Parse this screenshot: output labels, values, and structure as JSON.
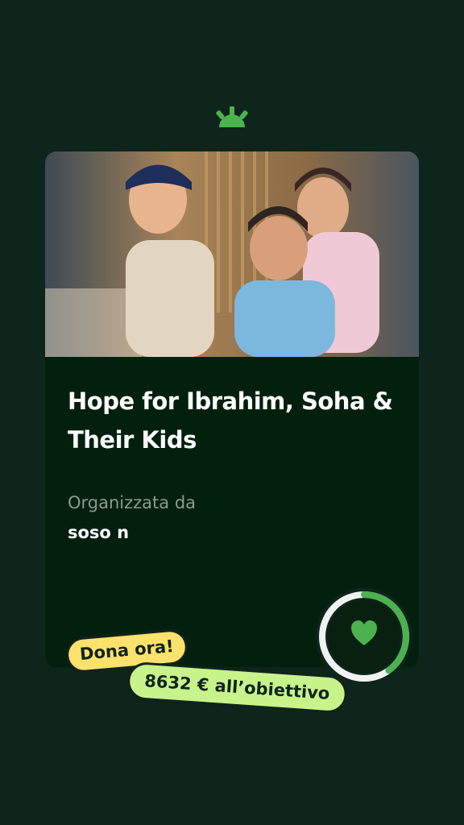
{
  "campaign": {
    "title": "Hope for Ibrahim, Soha & Their Kids",
    "organizer_label": "Organizzata da",
    "organizer_name": "soso n"
  },
  "cta": {
    "donate_label": "Dona ora!",
    "goal_text": "8632 € all’obiettivo"
  },
  "progress": {
    "fraction": 0.4
  },
  "icons": {
    "logo": "sunrise-logo-icon",
    "heart": "heart-icon"
  },
  "colors": {
    "background": "#0d251a",
    "card": "#03200f",
    "accent_green": "#4bb24f",
    "donate_yellow": "#fce16c",
    "goal_green": "#c7f38a"
  }
}
